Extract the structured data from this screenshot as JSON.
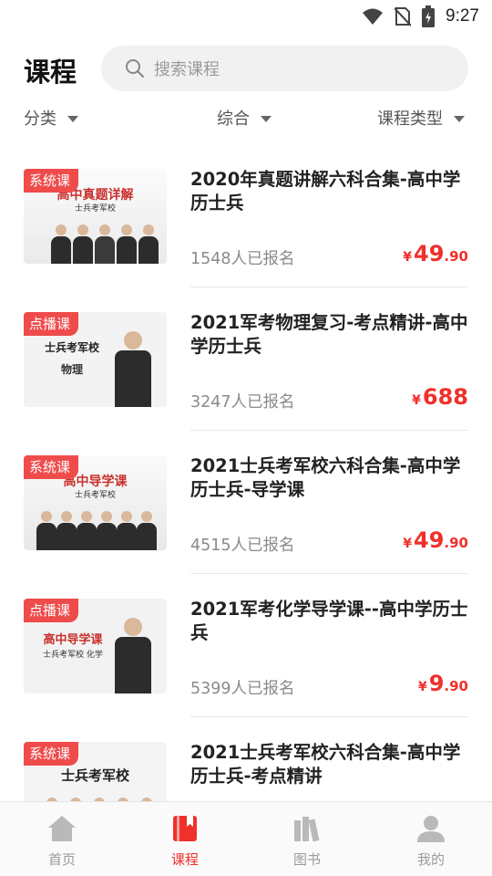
{
  "status": {
    "time": "9:27"
  },
  "header": {
    "title": "课程",
    "search_placeholder": "搜索课程"
  },
  "filters": [
    {
      "label": "分类"
    },
    {
      "label": "综合"
    },
    {
      "label": "课程类型"
    }
  ],
  "courses": [
    {
      "badge": "系统课",
      "title": "2020年真题讲解六科合集-高中学历士兵",
      "enrolled": "1548人已报名",
      "price_symbol": "¥",
      "price_int": "49",
      "price_dec": ".90",
      "thumb_text": "高中真题详解",
      "thumb_sub": "士兵考军校"
    },
    {
      "badge": "点播课",
      "title": "2021军考物理复习-考点精讲-高中学历士兵",
      "enrolled": "3247人已报名",
      "price_symbol": "¥",
      "price_int": "688",
      "price_dec": "",
      "thumb_text": "士兵考军校",
      "thumb_sub": "物理"
    },
    {
      "badge": "系统课",
      "title": "2021士兵考军校六科合集-高中学历士兵-导学课",
      "enrolled": "4515人已报名",
      "price_symbol": "¥",
      "price_int": "49",
      "price_dec": ".90",
      "thumb_text": "高中导学课",
      "thumb_sub": "士兵考军校"
    },
    {
      "badge": "点播课",
      "title": "2021军考化学导学课--高中学历士兵",
      "enrolled": "5399人已报名",
      "price_symbol": "¥",
      "price_int": "9",
      "price_dec": ".90",
      "thumb_text": "高中导学课",
      "thumb_sub": "士兵考军校 化学"
    },
    {
      "badge": "系统课",
      "title": "2021士兵考军校六科合集-高中学历士兵-考点精讲",
      "enrolled": "",
      "price_symbol": "",
      "price_int": "",
      "price_dec": "",
      "thumb_text": "士兵考军校",
      "thumb_sub": ""
    }
  ],
  "tabs": [
    {
      "label": "首页",
      "icon": "home-icon"
    },
    {
      "label": "课程",
      "icon": "course-icon"
    },
    {
      "label": "图书",
      "icon": "books-icon"
    },
    {
      "label": "我的",
      "icon": "profile-icon"
    }
  ],
  "colors": {
    "accent": "#f0302a",
    "badge": "#ef4b4b",
    "inactive": "#9a9a9a"
  }
}
